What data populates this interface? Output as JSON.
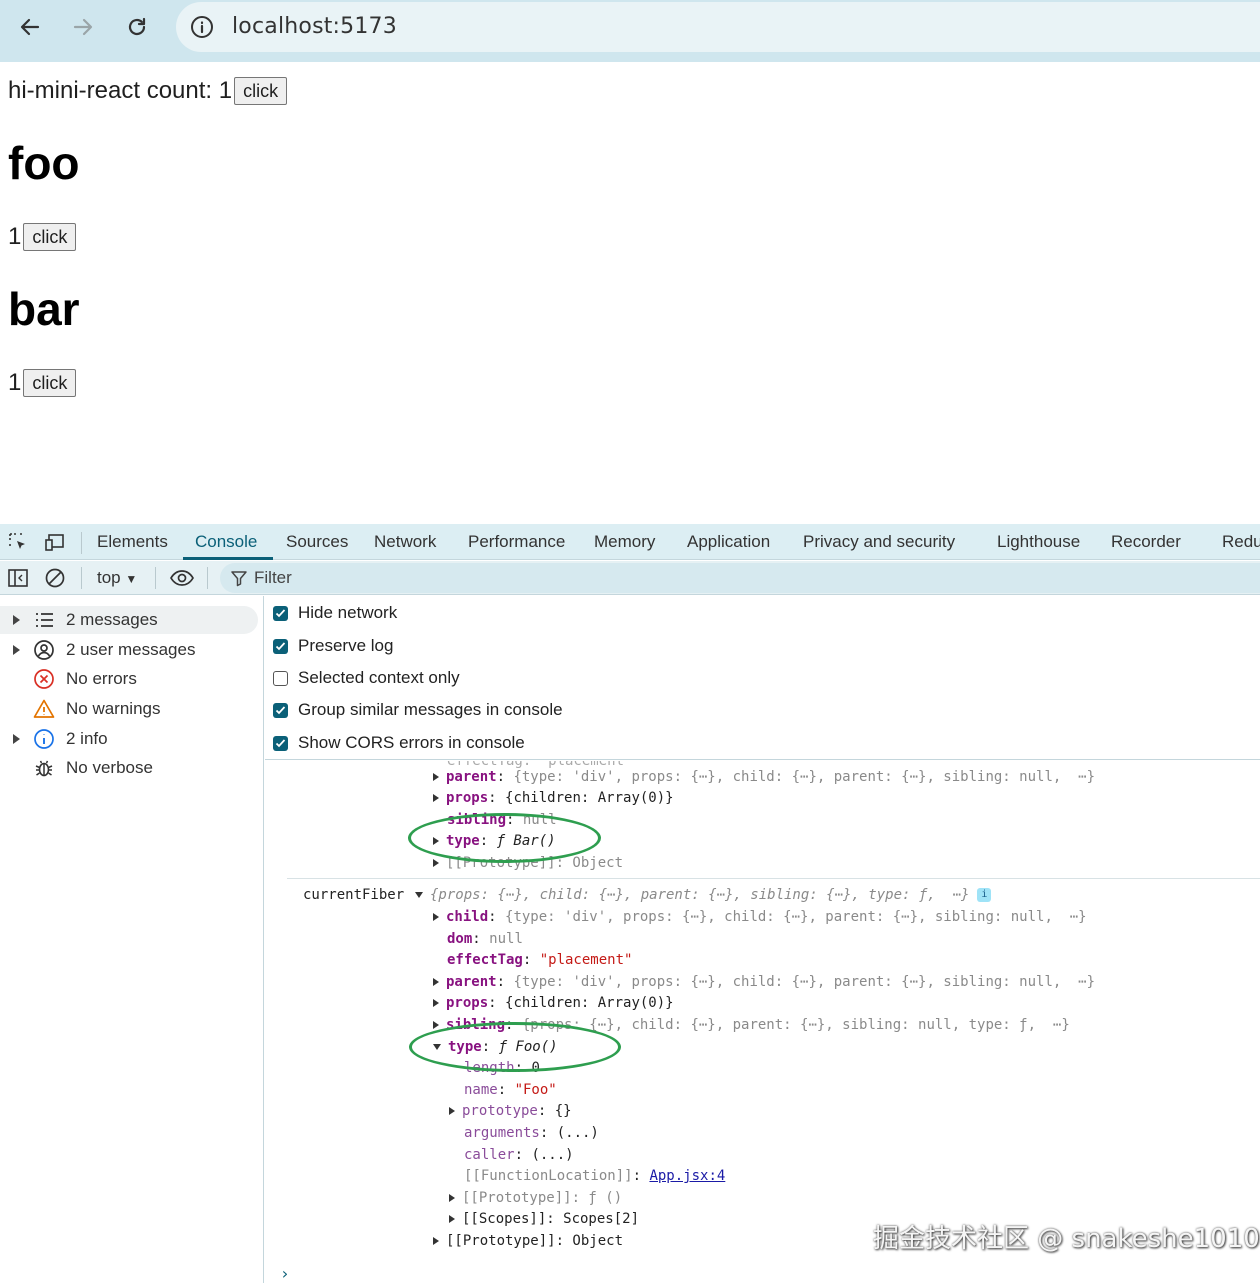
{
  "browser": {
    "url": "localhost:5173"
  },
  "page": {
    "row1_text": "hi-mini-react count: 1",
    "row1_button": "click",
    "heading_foo": "foo",
    "row2_count": "1",
    "row2_button": "click",
    "heading_bar": "bar",
    "row3_count": "1",
    "row3_button": "click"
  },
  "devtools": {
    "tabs": [
      "Elements",
      "Console",
      "Sources",
      "Network",
      "Performance",
      "Memory",
      "Application",
      "Privacy and security",
      "Lighthouse",
      "Recorder",
      "Redu"
    ],
    "active_tab": "Console",
    "toolbar": {
      "context": "top",
      "filter_placeholder": "Filter"
    },
    "sidebar": [
      {
        "label": "2 messages",
        "icon": "list-icon",
        "expandable": true,
        "selected": true
      },
      {
        "label": "2 user messages",
        "icon": "user-icon",
        "expandable": true
      },
      {
        "label": "No errors",
        "icon": "error-icon",
        "expandable": false
      },
      {
        "label": "No warnings",
        "icon": "warning-icon",
        "expandable": false
      },
      {
        "label": "2 info",
        "icon": "info-icon",
        "expandable": true
      },
      {
        "label": "No verbose",
        "icon": "bug-icon",
        "expandable": false
      }
    ],
    "settings": [
      {
        "label": "Hide network",
        "checked": true
      },
      {
        "label": "Preserve log",
        "checked": true
      },
      {
        "label": "Selected context only",
        "checked": false
      },
      {
        "label": "Group similar messages in console",
        "checked": true
      },
      {
        "label": "Show CORS errors in console",
        "checked": true
      }
    ],
    "accent_color": "#0b6078",
    "highlight_color": "#2e9e4f"
  },
  "console": {
    "top_partial": "effectTag: \"placement\"",
    "block1": {
      "parent": "{type: 'div', props: {⋯}, child: {⋯}, parent: {⋯}, sibling: null,  ⋯}",
      "props": "{children: Array(0)}",
      "sibling": "null",
      "type": "ƒ Bar()",
      "proto": "[[Prototype]]: Object"
    },
    "block2": {
      "label": "currentFiber",
      "summary": "{props: {⋯}, child: {⋯}, parent: {⋯}, sibling: {⋯}, type: ƒ,  ⋯}",
      "child": "{type: 'div', props: {⋯}, child: {⋯}, parent: {⋯}, sibling: null,  ⋯}",
      "dom": "null",
      "effectTag": "\"placement\"",
      "parent": "{type: 'div', props: {⋯}, child: {⋯}, parent: {⋯}, sibling: null,  ⋯}",
      "props": "{children: Array(0)}",
      "sibling": "{props: {⋯}, child: {⋯}, parent: {⋯}, sibling: null, type: ƒ,  ⋯}",
      "type": "ƒ Foo()",
      "length": "0",
      "name": "\"Foo\"",
      "prototype": "{}",
      "arguments": "(...)",
      "caller": "(...)",
      "function_location_key": "[[FunctionLocation]]",
      "function_location": "App.jsx:4",
      "fn_proto": "[[Prototype]]: ƒ ()",
      "scopes": "[[Scopes]]: Scopes[2]",
      "proto": "[[Prototype]]: Object"
    }
  },
  "watermark": "掘金技术社区 @ snakeshe1010"
}
